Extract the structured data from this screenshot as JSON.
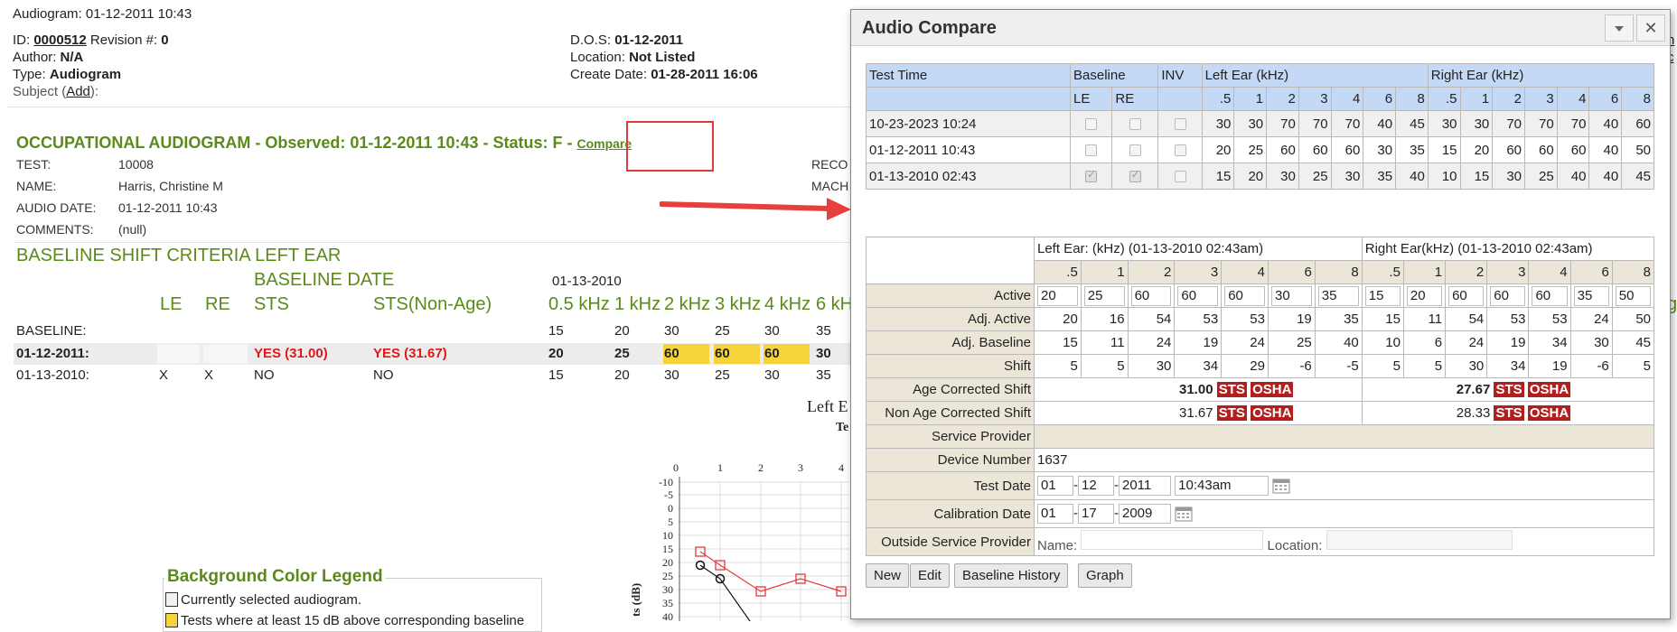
{
  "page": {
    "title": "Audiogram: 01-12-2011 10:43",
    "id_label": "ID:",
    "id_value": "0000512",
    "revision_label": "Revision #:",
    "revision_value": "0",
    "author_label": "Author:",
    "author_value": "N/A",
    "type_label": "Type:",
    "type_value": "Audiogram",
    "subject_label": "Subject (",
    "subject_link": "Add",
    "subject_end": "):",
    "dos_label": "D.O.S:",
    "dos_value": "01-12-2011",
    "location_label": "Location:",
    "location_value": "Not Listed",
    "create_label": "Create Date:",
    "create_value": "01-28-2011 16:06",
    "right_edge_link1": "h",
    "right_edge_link2": "c"
  },
  "occ": {
    "title": "OCCUPATIONAL AUDIOGRAM - Observed: 01-12-2011 10:43 - Status: F - ",
    "compare_link": "Compare",
    "fields": [
      {
        "label": "TEST:",
        "value": "10008"
      },
      {
        "label": "NAME:",
        "value": "Harris, Christine M"
      },
      {
        "label": "AUDIO DATE:",
        "value": "01-12-2011 10:43"
      },
      {
        "label": "COMMENTS:",
        "value": "(null)"
      }
    ],
    "reco_fragment": "RECO",
    "mach_fragment": "MACH"
  },
  "baseline_shift": {
    "heading": "BASELINE SHIFT CRITERIA LEFT EAR",
    "baseline_date_label": "BASELINE DATE",
    "baseline_date_value": "01-13-2010",
    "columns": [
      "LE",
      "RE",
      "STS",
      "STS(Non-Age)",
      "0.5 kHz",
      "1 kHz",
      "2 kHz",
      "3 kHz",
      "4 kHz",
      "6 kH"
    ],
    "rows": [
      {
        "label": "BASELINE:",
        "le": "",
        "re": "",
        "sts": "",
        "sts_non_age": "",
        "values": [
          "15",
          "20",
          "30",
          "25",
          "30",
          "35"
        ]
      },
      {
        "label": "01-12-2011:",
        "le": "",
        "re": "",
        "sts": "YES (31.00)",
        "sts_non_age": "YES (31.67)",
        "values": [
          "20",
          "25",
          "60",
          "60",
          "60",
          "30"
        ]
      },
      {
        "label": "01-13-2010:",
        "le": "X",
        "re": "X",
        "sts": "NO",
        "sts_non_age": "NO",
        "values": [
          "15",
          "20",
          "30",
          "25",
          "30",
          "35"
        ]
      }
    ],
    "edge_fragment": "g"
  },
  "legend": {
    "title": "Background Color Legend",
    "items": [
      "Currently selected audiogram.",
      "Tests where at least 15 dB above corresponding baseline"
    ],
    "colors": {
      "selected": "#f2f2f2",
      "threshold": "#f6d33a"
    }
  },
  "graph": {
    "title": "Left E",
    "subtitle": "Te",
    "x_ticks": [
      "0",
      "1",
      "2",
      "3",
      "4"
    ],
    "y_ticks": [
      "-10",
      "-5",
      "0",
      "5",
      "10",
      "15",
      "20",
      "25",
      "30",
      "35",
      "40"
    ],
    "ylabel": "ts (dB)"
  },
  "dialog": {
    "title": "Audio Compare",
    "collapse_icon": "chevron-down-icon",
    "close_icon": "close-icon",
    "compare_table": {
      "headers": {
        "test_time": "Test Time",
        "baseline": "Baseline",
        "inv": "INV",
        "left_ear": "Left Ear (kHz)",
        "right_ear": "Right Ear (kHz)"
      },
      "subheaders": {
        "le": "LE",
        "re": "RE"
      },
      "freqs": [
        ".5",
        "1",
        "2",
        "3",
        "4",
        "6",
        "8"
      ],
      "rows": [
        {
          "time": "10-23-2023 10:24",
          "le": false,
          "re": false,
          "inv": false,
          "left": [
            "30",
            "30",
            "70",
            "70",
            "70",
            "40",
            "45"
          ],
          "right": [
            "30",
            "30",
            "70",
            "70",
            "70",
            "40",
            "60"
          ]
        },
        {
          "time": "01-12-2011 10:43",
          "le": false,
          "re": false,
          "inv": false,
          "left": [
            "20",
            "25",
            "60",
            "60",
            "60",
            "30",
            "35"
          ],
          "right": [
            "15",
            "20",
            "60",
            "60",
            "60",
            "40",
            "50"
          ]
        },
        {
          "time": "01-13-2010 02:43",
          "le": true,
          "re": true,
          "inv": false,
          "left": [
            "15",
            "20",
            "30",
            "25",
            "30",
            "35",
            "40"
          ],
          "right": [
            "10",
            "15",
            "30",
            "25",
            "40",
            "40",
            "45"
          ]
        }
      ]
    },
    "detail_table": {
      "left_header": "Left Ear: (kHz) (01-13-2010 02:43am)",
      "right_header": "Right Ear(kHz) (01-13-2010 02:43am)",
      "freqs": [
        ".5",
        "1",
        "2",
        "3",
        "4",
        "6",
        "8"
      ],
      "active_label": "Active",
      "active_left": [
        "20",
        "25",
        "60",
        "60",
        "60",
        "30",
        "35"
      ],
      "active_right": [
        "15",
        "20",
        "60",
        "60",
        "60",
        "35",
        "50"
      ],
      "adj_active_label": "Adj. Active",
      "adj_active_left": [
        "20",
        "16",
        "54",
        "53",
        "53",
        "19",
        "35"
      ],
      "adj_active_right": [
        "15",
        "11",
        "54",
        "53",
        "53",
        "24",
        "50"
      ],
      "adj_baseline_label": "Adj. Baseline",
      "adj_baseline_left": [
        "15",
        "11",
        "24",
        "19",
        "24",
        "25",
        "40"
      ],
      "adj_baseline_right": [
        "10",
        "6",
        "24",
        "19",
        "34",
        "30",
        "45"
      ],
      "shift_label": "Shift",
      "shift_left": [
        "5",
        "5",
        "30",
        "34",
        "29",
        "-6",
        "-5"
      ],
      "shift_right": [
        "5",
        "5",
        "30",
        "34",
        "19",
        "-6",
        "5"
      ],
      "age_label": "Age Corrected Shift",
      "age_left": "31.00",
      "age_right": "27.67",
      "non_age_label": "Non Age Corrected Shift",
      "non_age_left": "31.67",
      "non_age_right": "28.33",
      "sts_tag": "STS",
      "osha_tag": "OSHA",
      "service_provider_label": "Service Provider",
      "device_number_label": "Device Number",
      "device_number_value": "1637",
      "test_date_label": "Test Date",
      "test_date": {
        "month": "01",
        "day": "12",
        "year": "2011",
        "time": "10:43am"
      },
      "calibration_label": "Calibration Date",
      "calibration_date": {
        "month": "01",
        "day": "17",
        "year": "2009"
      },
      "outside_label": "Outside Service Provider",
      "name_label": "Name:",
      "location_label": "Location:",
      "date_sep": "-"
    },
    "buttons": {
      "new": "New",
      "edit": "Edit",
      "baseline_history": "Baseline History",
      "graph": "Graph"
    }
  }
}
